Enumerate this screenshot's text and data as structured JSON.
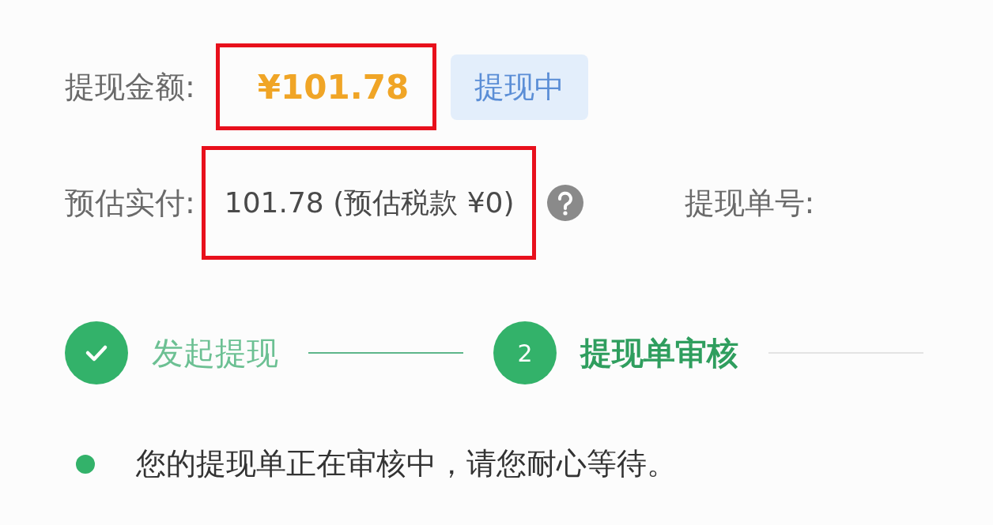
{
  "amount_row": {
    "label": "提现金额:",
    "amount": "¥101.78",
    "highlighted": true,
    "status_badge": "提现中"
  },
  "estimate_row": {
    "label": "预估实付:",
    "value": "101.78 (预估税款 ¥0)",
    "highlighted": true,
    "order_label": "提现单号:"
  },
  "steps": [
    {
      "label": "发起提现",
      "done": true,
      "current": false
    },
    {
      "number": "2",
      "label": "提现单审核",
      "done": false,
      "current": true
    }
  ],
  "note": "您的提现单正在审核中，请您耐心等待。"
}
